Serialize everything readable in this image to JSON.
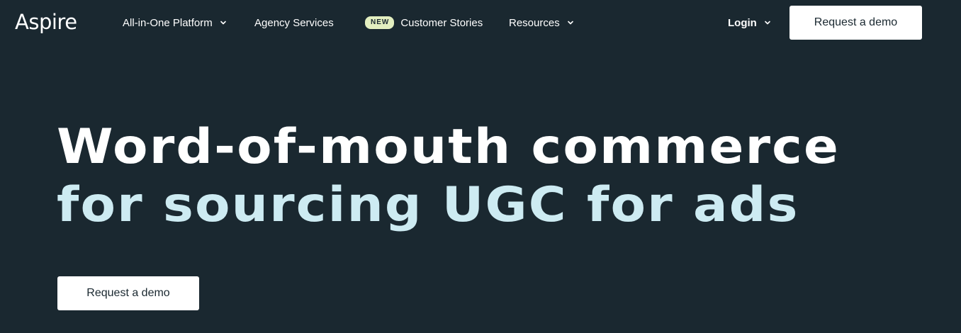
{
  "header": {
    "logo_text": "Aspire",
    "nav": {
      "platform_label": "All-in-One Platform",
      "agency_label": "Agency Services",
      "new_badge": "NEW",
      "stories_label": "Customer Stories",
      "resources_label": "Resources",
      "login_label": "Login"
    },
    "demo_button_label": "Request a demo"
  },
  "hero": {
    "headline_line1": "Word-of-mouth commerce",
    "headline_line2": "for sourcing UGC for ads",
    "demo_button_label": "Request a demo"
  },
  "colors": {
    "background": "#1a2830",
    "headline_primary": "#ffffff",
    "headline_accent": "#cdebf2",
    "badge_bg": "#e3efc0",
    "button_bg": "#ffffff",
    "button_text": "#1a2830"
  },
  "icons": {
    "dropdown": "chevron-down-icon"
  }
}
